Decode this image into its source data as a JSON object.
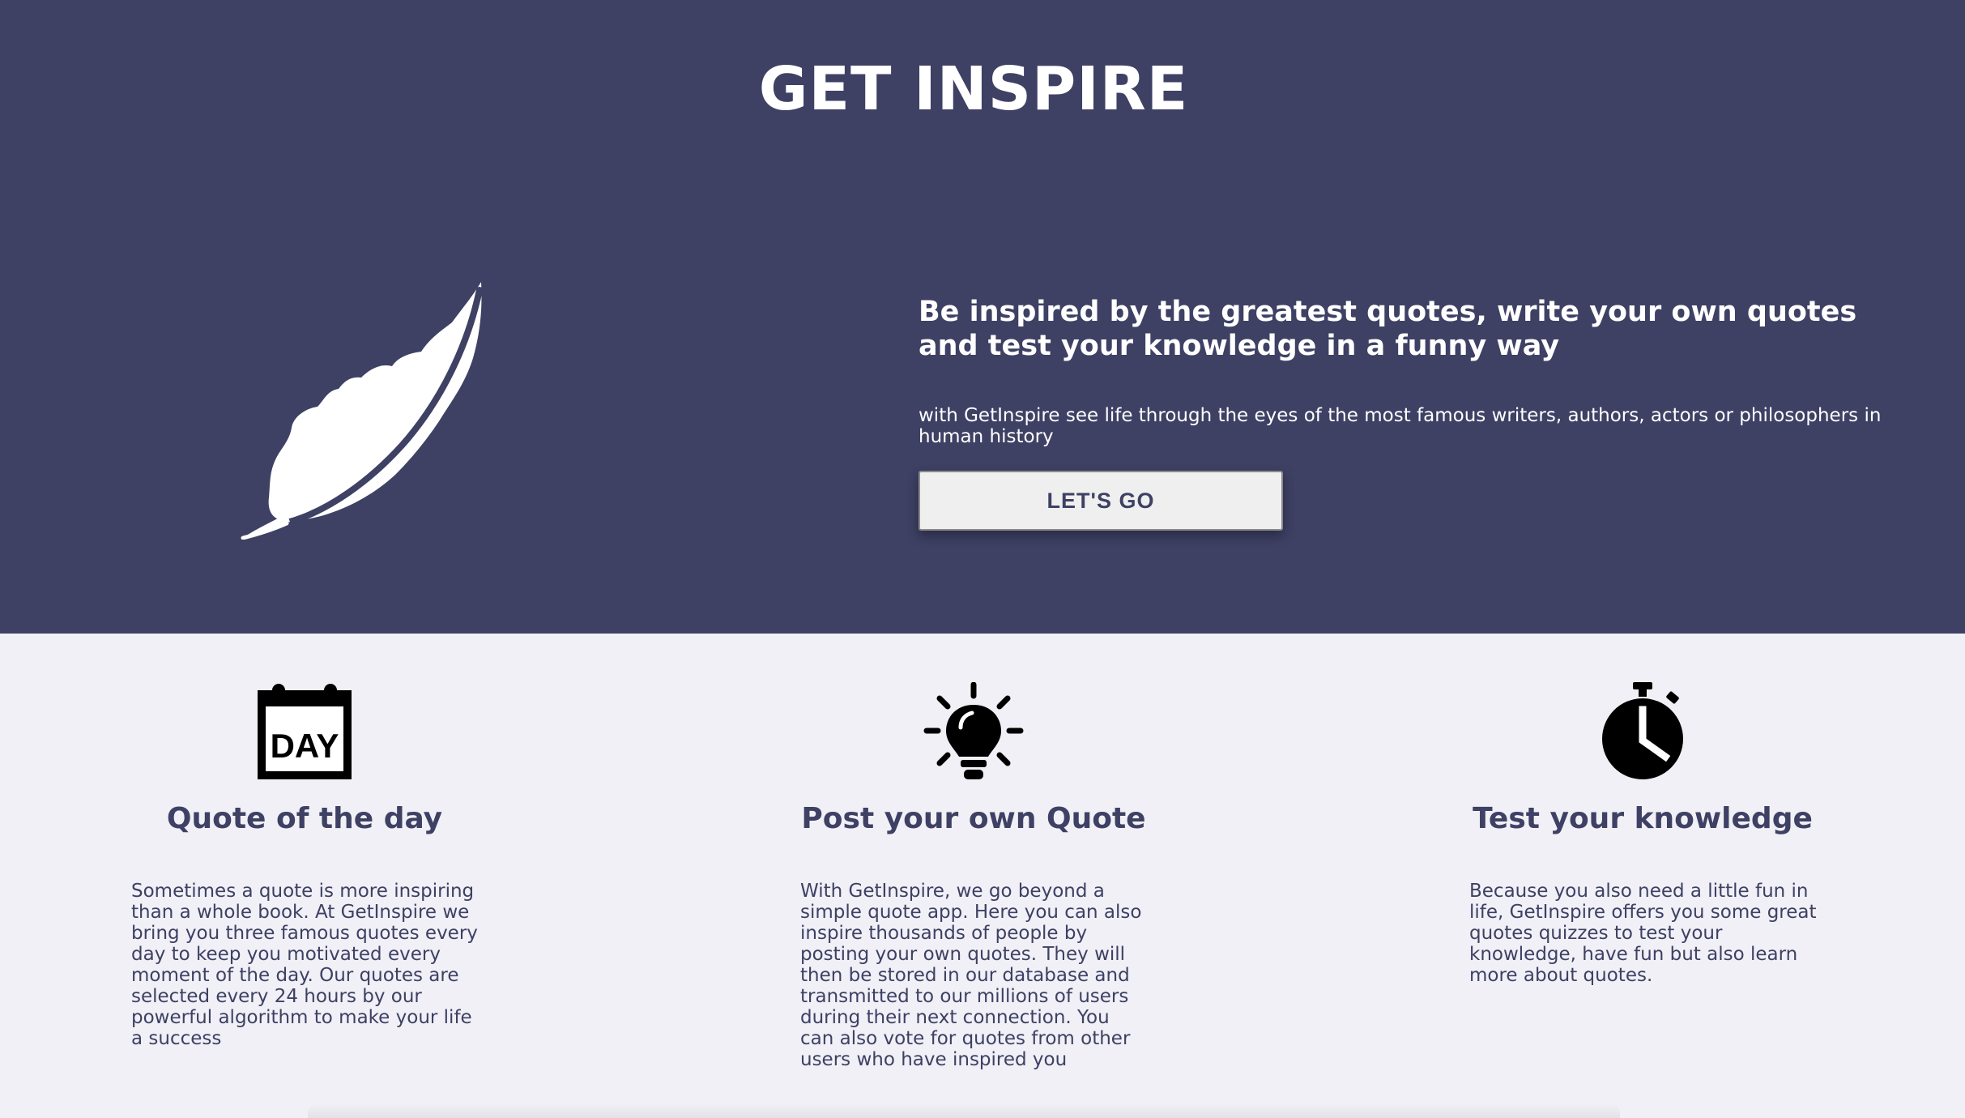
{
  "site": {
    "title": "GET INSPIRE"
  },
  "hero": {
    "headline": "Be inspired by the greatest quotes, write your own quotes and test your knowledge in a funny way",
    "subline": "with GetInspire see life through the eyes of the most famous writers, authors, actors or philosophers in human history",
    "cta_label": "LET'S GO",
    "illustration_icon": "feather-icon"
  },
  "features": [
    {
      "icon": "calendar-day-icon",
      "icon_text": "DAY",
      "title": "Quote of the day",
      "description": "Sometimes a quote is more inspiring than a whole book. At GetInspire we bring you three famous quotes every day to keep you motivated every moment of the day. Our quotes are selected every 24 hours by our powerful algorithm to make your life a success"
    },
    {
      "icon": "lightbulb-icon",
      "title": "Post your own Quote",
      "description": "With GetInspire, we go beyond a simple quote app. Here you can also inspire thousands of people by posting your own quotes. They will then be stored in our database and transmitted to our millions of users during their next connection. You can also vote for quotes from other users who have inspired you"
    },
    {
      "icon": "stopwatch-icon",
      "title": "Test your knowledge",
      "description": "Because you also need a little fun in life, GetInspire offers you some great quotes quizzes to test your knowledge, have fun but also learn more about quotes."
    }
  ],
  "colors": {
    "hero_background": "#3e4064",
    "page_background": "#f0f0f6",
    "text_dark": "#3e4064",
    "text_light": "#ffffff",
    "button_background": "#efefef"
  }
}
